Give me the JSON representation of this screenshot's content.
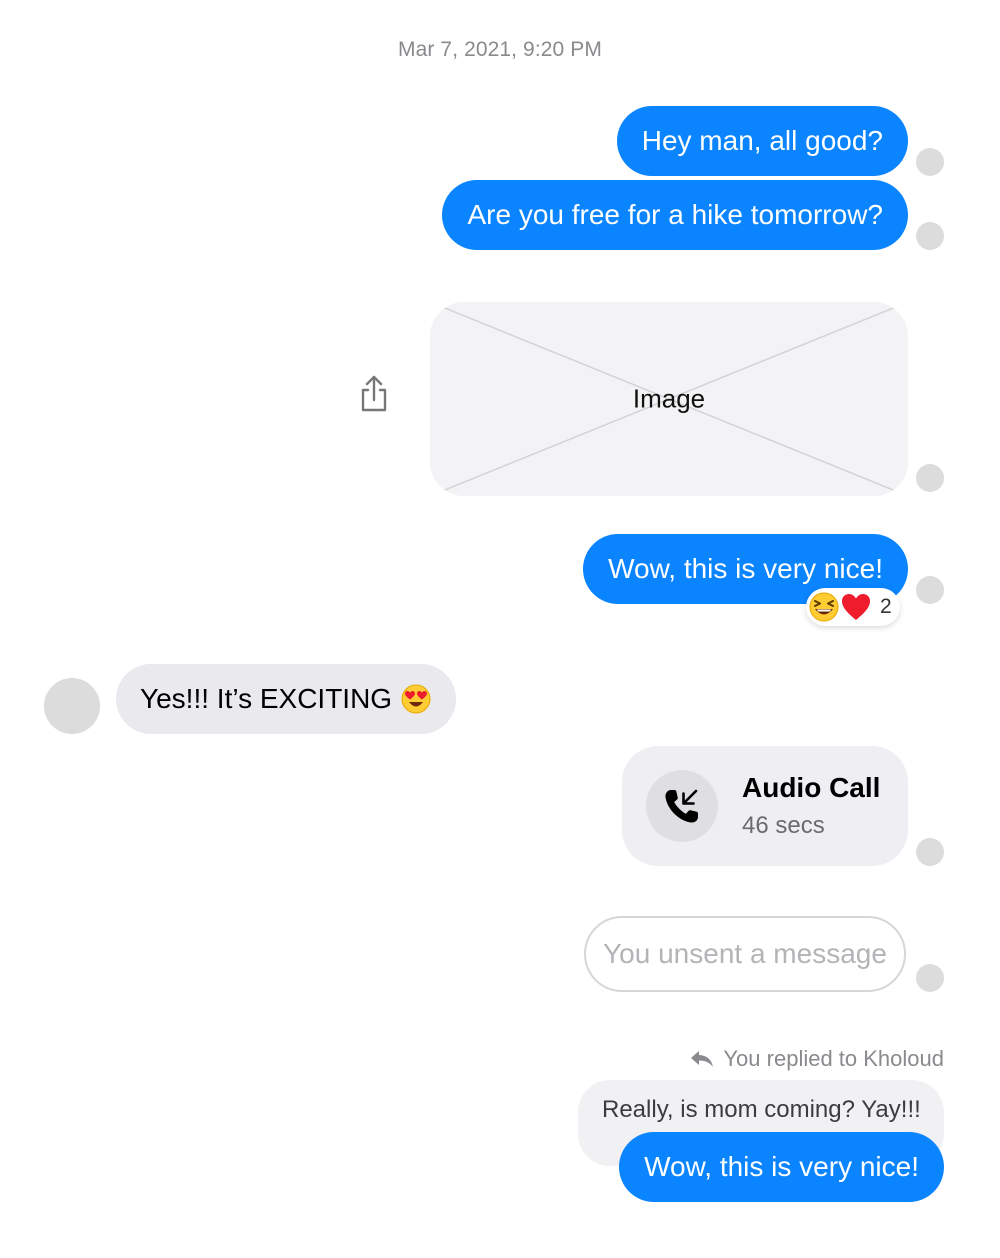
{
  "conversation": {
    "timestamp": "Mar 7, 2021, 9:20 PM",
    "messages": {
      "m1": {
        "text": "Hey man, all good?"
      },
      "m2": {
        "text": "Are you free for a hike tomorrow?"
      },
      "image": {
        "label": "Image",
        "share_icon": "share-icon"
      },
      "m3": {
        "text": "Wow, this is very nice!",
        "reactions": {
          "emojis": [
            "laughing-face",
            "red-heart"
          ],
          "count": "2"
        }
      },
      "incoming": {
        "text": "Yes!!! It’s EXCITING",
        "emoji": "heart-eyes-face"
      },
      "call": {
        "title": "Audio Call",
        "duration": "46 secs",
        "icon": "incoming-call-icon"
      },
      "unsent": {
        "text": "You unsent a message"
      },
      "reply": {
        "meta": "You replied to Kholoud",
        "quoted": "Really, is mom coming? Yay!!!",
        "text": "Wow, this is very nice!"
      }
    }
  },
  "colors": {
    "outgoing_bubble": "#0a84ff",
    "incoming_bubble": "#e9e9ee",
    "timestamp": "#8a8a8e",
    "receipt": "#dcdcdc"
  }
}
